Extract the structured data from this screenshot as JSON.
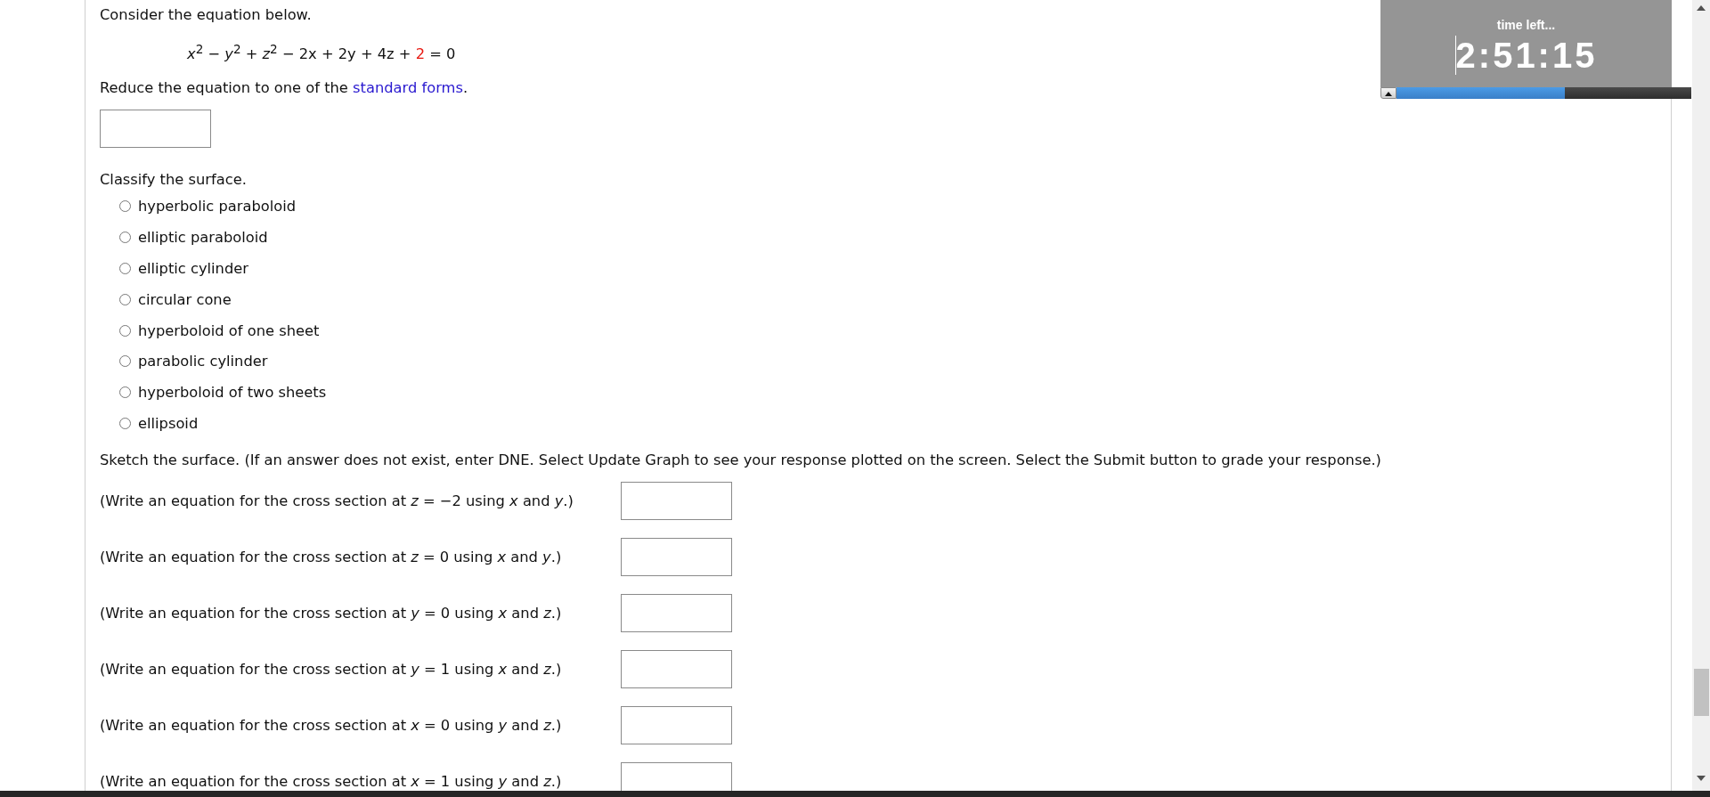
{
  "intro": "Consider the equation below.",
  "equation": {
    "before": "*x*$^{2}$ − *y*$^{2}$ + *z*$^{2}$ − 2x + 2y + 4z +",
    "constant": "2",
    "after": "= 0"
  },
  "reduce": {
    "text": "Reduce the equation to one of the",
    "link": "standard forms",
    "end": "."
  },
  "classify": "Classify the surface.",
  "options": [
    {
      "label": "hyperbolic paraboloid",
      "selected": false
    },
    {
      "label": "elliptic paraboloid",
      "selected": false
    },
    {
      "label": "elliptic cylinder",
      "selected": false
    },
    {
      "label": "circular cone",
      "selected": false
    },
    {
      "label": "hyperboloid of one sheet",
      "selected": false
    },
    {
      "label": "parabolic cylinder",
      "selected": false
    },
    {
      "label": "hyperboloid of two sheets",
      "selected": false
    },
    {
      "label": "ellipsoid",
      "selected": false
    }
  ],
  "sketch": "Sketch the surface. (If an answer does not exist, enter DNE. Select Update Graph to see your response plotted on the screen. Select the Submit button to grade your response.)",
  "cross_sections": [
    "(Write an equation for the cross section at *z* = −2 using *x* and *y*.)",
    "(Write an equation for the cross section at *z* = 0 using *x* and *y*.)",
    "(Write an equation for the cross section at *y* = 0 using *x* and *z*.)",
    "(Write an equation for the cross section at *y* = 1 using *x* and *z*.)",
    "(Write an equation for the cross section at *x* = 0 using *y* and *z*.)",
    "(Write an equation for the cross section at *x* = 1 using *y* and *z*.)"
  ],
  "timer": {
    "label": "time left...",
    "time": "2:51:15",
    "level": 0.57
  }
}
